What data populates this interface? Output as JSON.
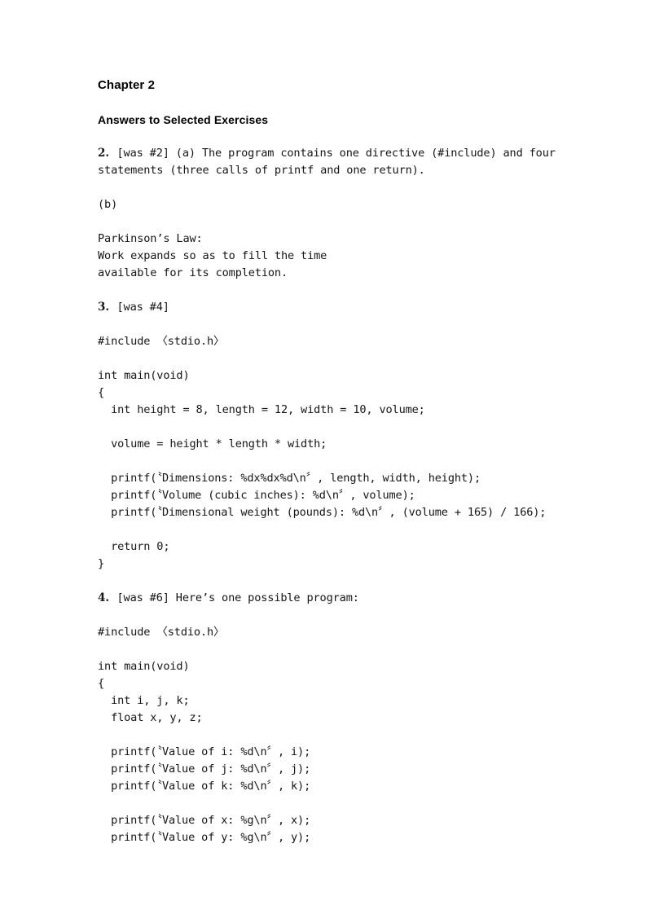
{
  "document": {
    "chapter_heading": "Chapter 2",
    "section_heading": "Answers to Selected Exercises"
  },
  "answers": [
    {
      "number": "2.",
      "body": "[was #2] (a) The program contains one directive (#include) and four statements (three calls of printf and one return)."
    },
    {
      "number": "3.",
      "body": "[was #4]"
    },
    {
      "number": "4.",
      "body": "[was #6] Here’s one possible program:"
    }
  ],
  "part_b": {
    "label": "(b)",
    "quote": "Parkinson’s Law:\nWork expands so as to fill the time\navailable for its completion."
  },
  "code_blocks": [
    {
      "id": "program-exercise-3",
      "include": "#include 〈stdio.h〉",
      "source": "int main(void)\n{\n  int height = 8, length = 12, width = 10, volume;\n\n  volume = height * length * width;\n\n  printf(〝Dimensions: %dx%dx%d\\n〞, length, width, height);\n  printf(〝Volume (cubic inches): %d\\n〞, volume);\n  printf(〝Dimensional weight (pounds): %d\\n〞, (volume + 165) / 166);\n\n  return 0;\n}"
    },
    {
      "id": "program-exercise-4",
      "include": "#include 〈stdio.h〉",
      "source": "int main(void)\n{\n  int i, j, k;\n  float x, y, z;\n\n  printf(〝Value of i: %d\\n〞, i);\n  printf(〝Value of j: %d\\n〞, j);\n  printf(〝Value of k: %d\\n〞, k);\n\n  printf(〝Value of x: %g\\n〞, x);\n  printf(〝Value of y: %g\\n〞, y);"
    }
  ],
  "colors": {
    "page_background": "#ffffff",
    "text": "#151515",
    "heading": "#000000"
  }
}
